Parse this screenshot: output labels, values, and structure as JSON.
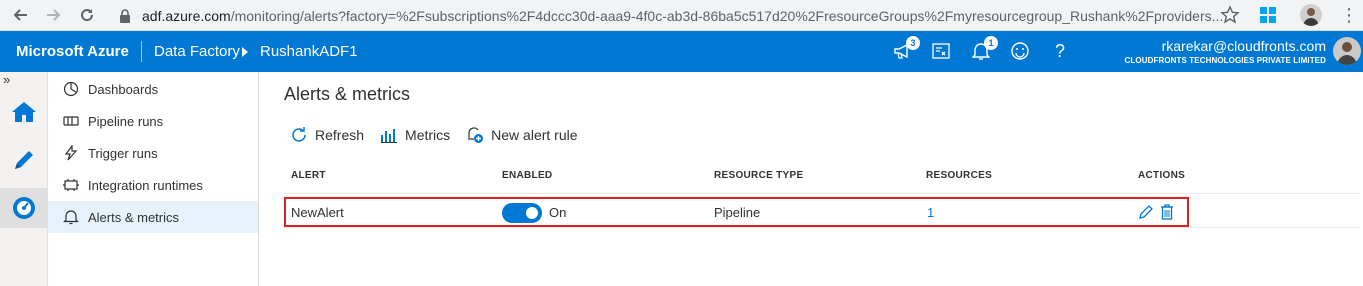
{
  "browser": {
    "url_host": "adf.azure.com",
    "url_path": "/monitoring/alerts?factory=%2Fsubscriptions%2F4dccc30d-aaa9-4f0c-ab3d-86ba5c517d20%2FresourceGroups%2Fmyresourcegroup_Rushank%2Fproviders..."
  },
  "header": {
    "brand": "Microsoft Azure",
    "service": "Data Factory",
    "factory": "RushankADF1",
    "feedback_badge": "3",
    "notifications_badge": "1",
    "user_email": "rkarekar@cloudfronts.com",
    "user_org": "CLOUDFRONTS TECHNOLOGIES PRIVATE LIMITED",
    "help_glyph": "?"
  },
  "rail": {
    "expand_glyph": "»"
  },
  "subnav": {
    "items": [
      {
        "label": "Dashboards",
        "icon": "dashboard-icon"
      },
      {
        "label": "Pipeline runs",
        "icon": "pipeline-icon"
      },
      {
        "label": "Trigger runs",
        "icon": "trigger-icon"
      },
      {
        "label": "Integration runtimes",
        "icon": "integration-runtime-icon"
      },
      {
        "label": "Alerts & metrics",
        "icon": "bell-icon",
        "active": true
      }
    ]
  },
  "main": {
    "title": "Alerts & metrics",
    "toolbar": {
      "refresh": "Refresh",
      "metrics": "Metrics",
      "new_alert": "New alert rule"
    },
    "table": {
      "columns": [
        "ALERT",
        "ENABLED",
        "RESOURCE TYPE",
        "RESOURCES",
        "ACTIONS"
      ],
      "rows": [
        {
          "alert": "NewAlert",
          "enabled": true,
          "enabled_label": "On",
          "resource_type": "Pipeline",
          "resources": "1"
        }
      ]
    }
  },
  "colors": {
    "accent": "#0078d4",
    "highlight": "#e02020"
  }
}
